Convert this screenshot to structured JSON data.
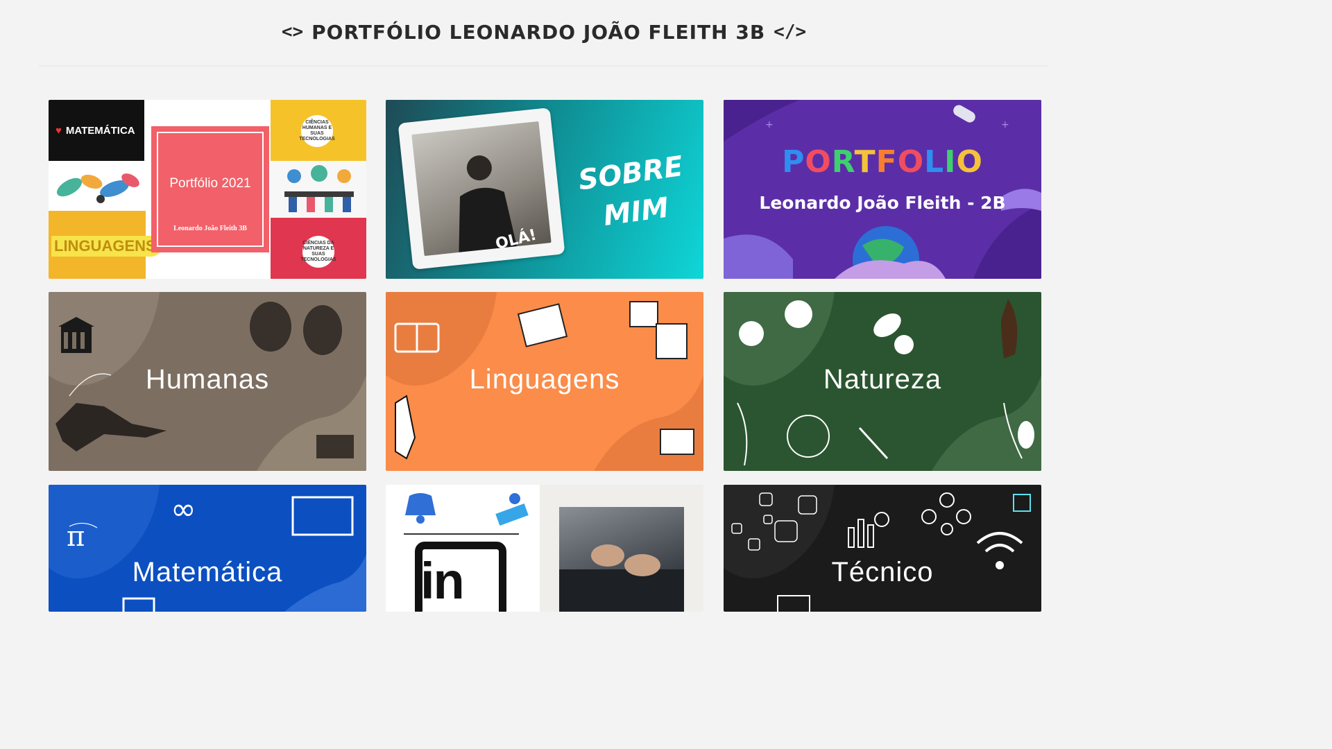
{
  "header": {
    "left_code": "<>",
    "title": "Portfólio Leonardo João Fleith 3B",
    "right_code": "</>"
  },
  "cards": {
    "portfolio_2021": {
      "collage_matematica": "MATEMÁTICA",
      "collage_linguagens": "LINGUAGENS",
      "collage_humanas": "CIÊNCIAS HUMANAS E SUAS TECNOLOGIAS",
      "collage_natureza": "CIÊNCIAS DA NATUREZA E SUAS TECNOLOGIAS",
      "title": "Portfólio 2021",
      "subtitle": "Leonardo João Fleith 3B"
    },
    "sobre_mim": {
      "greeting": "OLÁ!",
      "title_line1": "SOBRE",
      "title_line2": "MIM"
    },
    "portfolio_cover": {
      "title": "PORTFOLIO",
      "subtitle": "Leonardo João Fleith - 2B"
    },
    "humanas": {
      "label": "Humanas"
    },
    "linguagens": {
      "label": "Linguagens"
    },
    "natureza": {
      "label": "Natureza"
    },
    "matematica": {
      "label": "Matemática"
    },
    "linkedin": {
      "icon_text": "in"
    },
    "tecnico": {
      "label": "Técnico"
    }
  },
  "colors": {
    "background": "#f3f3f3",
    "humanas": "#7c6f62",
    "linguagens": "#fb8c4a",
    "natureza": "#2a5530",
    "matematica": "#0c4fc0",
    "tecnico": "#1b1b1b",
    "portfolio_cover": "#5b2ea8",
    "sobre_mim": "#0fd6d8"
  }
}
